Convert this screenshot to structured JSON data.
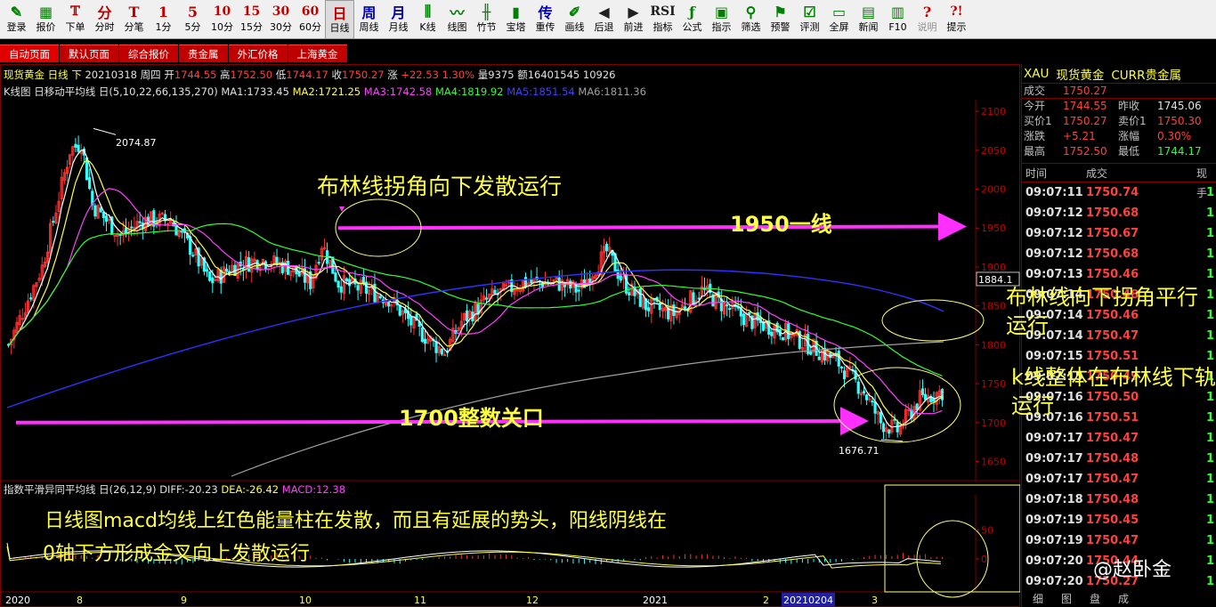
{
  "toolbar": [
    {
      "icon": "pen-icon",
      "glyph": "✎",
      "label": "登录"
    },
    {
      "icon": "grid-icon",
      "glyph": "▦",
      "label": "报价"
    },
    {
      "icon": "tick-chart-icon",
      "glyph": "𝕋",
      "label": "下单"
    },
    {
      "icon": "min-text",
      "glyph": "分",
      "label": "分时"
    },
    {
      "icon": "t-icon",
      "glyph": "T",
      "label": "分笔"
    },
    {
      "icon": "num-1",
      "glyph": "1",
      "label": "1分"
    },
    {
      "icon": "num-5",
      "glyph": "5",
      "label": "5分"
    },
    {
      "icon": "num-10",
      "glyph": "10",
      "label": "10分"
    },
    {
      "icon": "num-15",
      "glyph": "15",
      "label": "15分"
    },
    {
      "icon": "num-30",
      "glyph": "30",
      "label": "30分"
    },
    {
      "icon": "num-60",
      "glyph": "60",
      "label": "60分"
    },
    {
      "icon": "day-char",
      "glyph": "日",
      "label": "日线"
    },
    {
      "icon": "week-char",
      "glyph": "周",
      "label": "周线"
    },
    {
      "icon": "month-char",
      "glyph": "月",
      "label": "月线"
    },
    {
      "icon": "kline-icon",
      "glyph": "⫼",
      "label": "K线"
    },
    {
      "icon": "line-chart-icon",
      "glyph": "〰",
      "label": "线图"
    },
    {
      "icon": "bamboo-icon",
      "glyph": "╫",
      "label": "竹节"
    },
    {
      "icon": "tower-icon",
      "glyph": "▮",
      "label": "宝塔"
    },
    {
      "icon": "transmit-char",
      "glyph": "传",
      "label": "重传"
    },
    {
      "icon": "draw-icon",
      "glyph": "✐",
      "label": "画线"
    },
    {
      "icon": "back-icon",
      "glyph": "◀",
      "label": "后退"
    },
    {
      "icon": "forward-icon",
      "glyph": "▶",
      "label": "前进"
    },
    {
      "icon": "rsi-icon",
      "glyph": "RSI",
      "label": "指标"
    },
    {
      "icon": "formula-icon",
      "glyph": "ƒ",
      "label": "公式"
    },
    {
      "icon": "indicator-icon",
      "glyph": "▣",
      "label": "指示"
    },
    {
      "icon": "filter-icon",
      "glyph": "⚲",
      "label": "筛选"
    },
    {
      "icon": "alert-icon",
      "glyph": "⚑",
      "label": "预警"
    },
    {
      "icon": "evaluate-icon",
      "glyph": "☑",
      "label": "评测"
    },
    {
      "icon": "fullscreen-icon",
      "glyph": "▭",
      "label": "全屏"
    },
    {
      "icon": "news-icon",
      "glyph": "▤",
      "label": "新闻"
    },
    {
      "icon": "f10-icon",
      "glyph": "▥",
      "label": "F10"
    },
    {
      "icon": "explain-icon",
      "glyph": "?",
      "label": "说明"
    },
    {
      "icon": "hint-icon",
      "glyph": "?!",
      "label": "提示"
    }
  ],
  "tabs": [
    "自动页面",
    "默认页面",
    "综合报价",
    "贵金属",
    "外汇价格",
    "上海黄金"
  ],
  "info": {
    "name": "现货黄金",
    "period": "日线",
    "direction": "下",
    "date": "20210318",
    "weekday": "周四",
    "open_label": "开",
    "open": "1744.55",
    "high_label": "高",
    "high": "1752.50",
    "low_label": "低",
    "low": "1744.17",
    "close_label": "收",
    "close": "1750.27",
    "change_label": "涨",
    "change": "+22.53",
    "change_pct": "1.30%",
    "volume": "量9375",
    "amount": "额16401545 10926"
  },
  "ma": {
    "title": "K线图 日移动平均线 日(5,10,22,66,135,270)",
    "ma1": "MA1:1733.45",
    "ma2": "MA2:1721.25",
    "ma3": "MA3:1742.58",
    "ma4": "MA4:1819.92",
    "ma5": "MA5:1851.54",
    "ma6": "MA6:1811.36"
  },
  "macd": {
    "title": "指数平滑异同平均线 日(26,12,9)",
    "diff": "DIFF:-20.23",
    "dea": "DEA:-26.42",
    "macd": "MACD:12.38"
  },
  "price_axis": [
    "2100",
    "2050",
    "2000",
    "1950",
    "1900",
    "1850",
    "1800",
    "1750",
    "1700",
    "1650"
  ],
  "price_box": "1884.1",
  "macd_axis": [
    "50",
    "0"
  ],
  "x_axis": [
    {
      "label": "2020",
      "color": "#ffffff"
    },
    {
      "label": "8",
      "color": "#ffff40"
    },
    {
      "label": "9",
      "color": "#ffff40"
    },
    {
      "label": "10",
      "color": "#ffff40"
    },
    {
      "label": "11",
      "color": "#ffff40"
    },
    {
      "label": "12",
      "color": "#ffff40"
    },
    {
      "label": "2021",
      "color": "#ffffff"
    },
    {
      "label": "2",
      "color": "#ffff40"
    },
    {
      "label": "20210204",
      "color": "#ffffff"
    },
    {
      "label": "3",
      "color": "#ffff40"
    }
  ],
  "labels": {
    "high_point": "2074.87",
    "low_point": "1676.71"
  },
  "annotations": {
    "bollinger_top": "布林线拐角向下发散运行",
    "line_1950": "1950一线",
    "level_1700": "1700整数关口",
    "bollinger_right": "布林线向下拐角平行运行",
    "k_line_note": "k线整体在布林线下轨运行",
    "macd_note_1": "日线图macd均线上红色能量柱在发散，而且有延展的势头，阳线阴线在",
    "macd_note_2": "0轴下方形成金叉向上发散运行"
  },
  "quote": {
    "code": "XAU",
    "name": "现货黄金",
    "market": "CURR贵金属",
    "last_label": "成交",
    "last": "1750.27",
    "rows": [
      {
        "l1": "今开",
        "v1": "1744.55",
        "c1": "#ff4040",
        "l2": "昨收",
        "v2": "1745.06",
        "c2": "#e0e0e0"
      },
      {
        "l1": "买价1",
        "v1": "1750.27",
        "c1": "#ff4040",
        "l2": "卖价1",
        "v2": "1750.30",
        "c2": "#ff4040"
      },
      {
        "l1": "涨跌",
        "v1": "+5.21",
        "c1": "#ff4040",
        "l2": "涨幅",
        "v2": "0.30%",
        "c2": "#ff4040"
      },
      {
        "l1": "最高",
        "v1": "1752.50",
        "c1": "#ff4040",
        "l2": "最低",
        "v2": "1744.17",
        "c2": "#30ff30"
      }
    ]
  },
  "trade_head": {
    "time": "时间",
    "price": "成交",
    "vol": "现手"
  },
  "trades": [
    {
      "time": "09:07:11",
      "price": "1750.74",
      "vol": "1"
    },
    {
      "time": "09:07:12",
      "price": "1750.68",
      "vol": "1"
    },
    {
      "time": "09:07:12",
      "price": "1750.67",
      "vol": "1"
    },
    {
      "time": "09:07:12",
      "price": "1750.68",
      "vol": "1"
    },
    {
      "time": "09:07:13",
      "price": "1750.46",
      "vol": "1"
    },
    {
      "time": "09:07:14",
      "price": "1750.48",
      "vol": "1"
    },
    {
      "time": "09:07:14",
      "price": "1750.46",
      "vol": "1"
    },
    {
      "time": "09:07:14",
      "price": "1750.47",
      "vol": "1"
    },
    {
      "time": "09:07:15",
      "price": "1750.51",
      "vol": "1"
    },
    {
      "time": "09:07:15",
      "price": "1750.49",
      "vol": "1"
    },
    {
      "time": "09:07:16",
      "price": "1750.50",
      "vol": "1"
    },
    {
      "time": "09:07:16",
      "price": "1750.51",
      "vol": "1"
    },
    {
      "time": "09:07:17",
      "price": "1750.47",
      "vol": "1"
    },
    {
      "time": "09:07:17",
      "price": "1750.48",
      "vol": "1"
    },
    {
      "time": "09:07:17",
      "price": "1750.47",
      "vol": "1"
    },
    {
      "time": "09:07:18",
      "price": "1750.48",
      "vol": "1"
    },
    {
      "time": "09:07:19",
      "price": "1750.45",
      "vol": "1"
    },
    {
      "time": "09:07:19",
      "price": "1750.47",
      "vol": "1"
    },
    {
      "time": "09:07:20",
      "price": "1750.44",
      "vol": "1"
    },
    {
      "time": "09:07:20",
      "price": "1750.27",
      "vol": "1"
    }
  ],
  "watermark": "@赵卧金",
  "bottom_tabs": [
    "细",
    "图",
    "盘",
    "成"
  ]
}
